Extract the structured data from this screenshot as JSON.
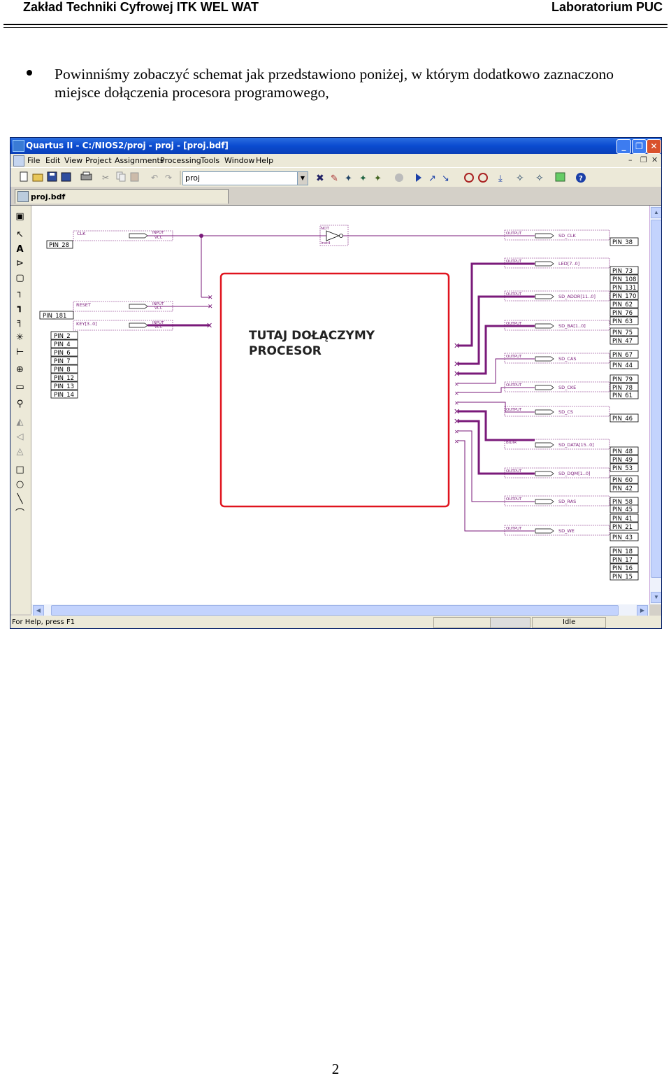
{
  "header": {
    "left": "Zakład Techniki Cyfrowej ITK WEL WAT",
    "right": "Laboratorium PUC"
  },
  "paragraph": "Powinniśmy zobaczyć schemat jak przedstawiono poniżej, w którym dodatkowo zaznaczono miejsce dołączenia procesora programowego,",
  "page_number": "2",
  "screenshot": {
    "title": "Quartus II - C:/NIOS2/proj - proj - [proj.bdf]",
    "menu": [
      "File",
      "Edit",
      "View",
      "Project",
      "Assignments",
      "Processing",
      "Tools",
      "Window",
      "Help"
    ],
    "project_combo": "proj",
    "tab": "proj.bdf",
    "status_help": "For Help, press F1",
    "status_state": "Idle",
    "processor_label_line1": "TUTAJ DOŁĄCZYMY",
    "processor_label_line2": "PROCESOR",
    "inputs": [
      {
        "pin": "PIN_28",
        "name": "CLK"
      },
      {
        "pin": "PIN_181",
        "name": "RESET"
      },
      {
        "pin": "",
        "name": "KEY[3..0]"
      }
    ],
    "key_pins": [
      "PIN_2",
      "PIN_4",
      "PIN_6",
      "PIN_7",
      "PIN_8",
      "PIN_12",
      "PIN_13",
      "PIN_14"
    ],
    "not_gate": {
      "type": "NOT",
      "inst": "inst4"
    },
    "io_labels": {
      "input": "INPUT",
      "vcc": "VCC",
      "output": "OUTPUT",
      "bidir": "BIDIR"
    },
    "outputs": [
      {
        "name": "SD_CLK",
        "kind": "OUTPUT"
      },
      {
        "name": "LED[7..0]",
        "kind": "OUTPUT"
      },
      {
        "name": "SD_ADDR[11..0]",
        "kind": "OUTPUT"
      },
      {
        "name": "SD_BA[1..0]",
        "kind": "OUTPUT"
      },
      {
        "name": "SD_CAS",
        "kind": "OUTPUT"
      },
      {
        "name": "SD_CKE",
        "kind": "OUTPUT"
      },
      {
        "name": "SD_CS",
        "kind": "OUTPUT"
      },
      {
        "name": "SD_DATA[15..0]",
        "kind": "BIDIR"
      },
      {
        "name": "SD_DQM[1..0]",
        "kind": "OUTPUT"
      },
      {
        "name": "SD_RAS",
        "kind": "OUTPUT"
      },
      {
        "name": "SD_WE",
        "kind": "OUTPUT"
      }
    ],
    "out_pins": [
      "PIN_38",
      "PIN_73",
      "PIN_108",
      "PIN_131",
      "PIN_170",
      "PIN_62",
      "PIN_76",
      "PIN_63",
      "PIN_75",
      "PIN_47",
      "PIN_67",
      "PIN_44",
      "PIN_79",
      "PIN_78",
      "PIN_61",
      "PIN_46",
      "PIN_48",
      "PIN_49",
      "PIN_53",
      "PIN_60",
      "PIN_42",
      "PIN_58",
      "PIN_45",
      "PIN_41",
      "PIN_21",
      "PIN_43",
      "PIN_18",
      "PIN_17",
      "PIN_16",
      "PIN_15"
    ]
  }
}
